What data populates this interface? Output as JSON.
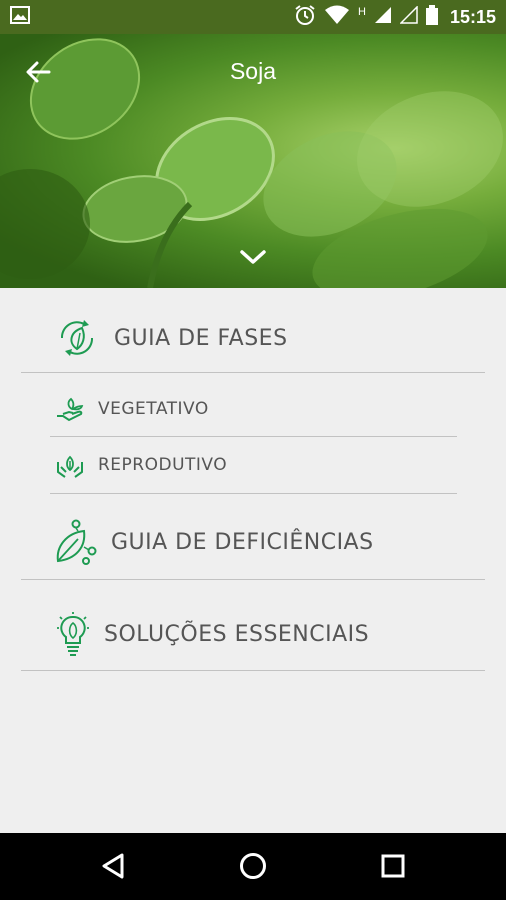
{
  "status_bar": {
    "time": "15:15",
    "network_label": "H",
    "icons": [
      "image-notification-icon",
      "alarm-icon",
      "wifi-icon",
      "cell-signal-icon",
      "cell-signal-empty-icon",
      "battery-icon"
    ]
  },
  "header": {
    "title": "Soja",
    "back_icon": "arrow-left-icon",
    "expand_icon": "chevron-down-icon"
  },
  "menu": {
    "guia_fases": {
      "label": "GUIA DE FASES",
      "icon": "leaf-cycle-icon"
    },
    "sub_items": [
      {
        "label": "VEGETATIVO",
        "icon": "hand-plant-icon"
      },
      {
        "label": "REPRODUTIVO",
        "icon": "hands-plant-icon"
      }
    ],
    "guia_deficiencias": {
      "label": "GUIA DE DEFICIÊNCIAS",
      "icon": "leaf-nodes-icon"
    },
    "solucoes": {
      "label": "SOLUÇÕES ESSENCIAIS",
      "icon": "lightbulb-leaf-icon"
    }
  },
  "nav_bar": {
    "icons": [
      "back-triangle-icon",
      "home-circle-icon",
      "recents-square-icon"
    ]
  },
  "colors": {
    "status_bar": "#4a6a1f",
    "accent_green": "#1e9b52",
    "text": "#555555",
    "background": "#efefef"
  }
}
